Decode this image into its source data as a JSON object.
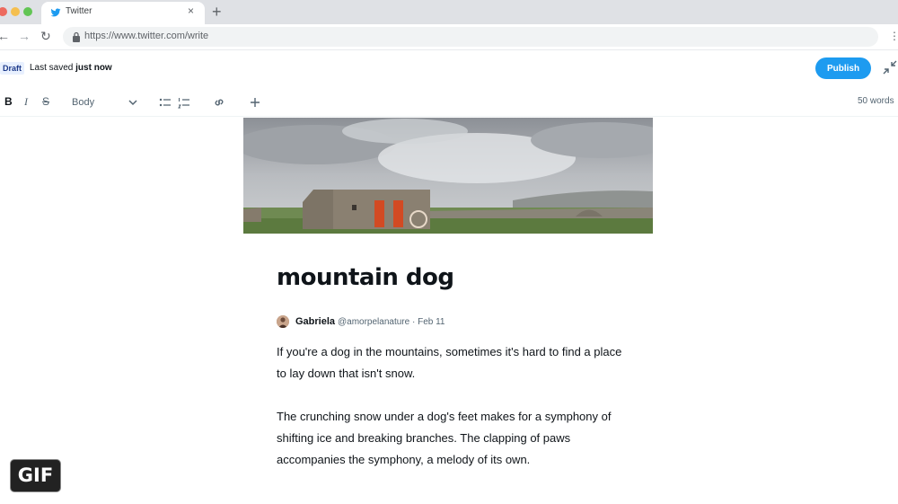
{
  "browser": {
    "tab_title": "Twitter",
    "tab_close": "×",
    "new_tab": "+",
    "url": "https://www.twitter.com/write",
    "back": "←",
    "forward": "→",
    "reload": "↻",
    "menu": "⋮"
  },
  "header": {
    "draft_label": "Draft",
    "save_prefix": "Last saved",
    "save_time": "just now",
    "publish_label": "Publish"
  },
  "formatting": {
    "bold": "B",
    "italic": "I",
    "strike": "S",
    "style_select": "Body",
    "word_count": "50 words"
  },
  "article": {
    "title": "mountain dog",
    "author_name": "Gabriela",
    "author_handle": "@amorpelanature · Feb 11",
    "paragraph_1": "If you're a dog in the mountains, sometimes it's hard to find a place to lay down that isn't snow.",
    "paragraph_2": "The crunching snow under a dog's feet makes for a symphony of shifting ice and breaking branches. The clapping of paws accompanies the symphony, a melody of its own."
  },
  "overlay": {
    "gif_badge": "GIF"
  },
  "colors": {
    "accent": "#1d9bf0",
    "draft_badge_bg": "#e8f0fe"
  }
}
